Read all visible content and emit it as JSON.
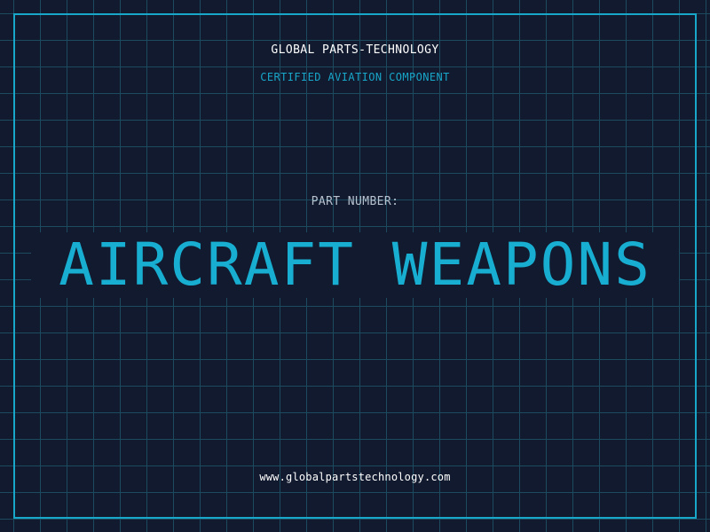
{
  "header": {
    "company": "GLOBAL PARTS-TECHNOLOGY",
    "subtitle": "CERTIFIED AVIATION COMPONENT"
  },
  "part": {
    "label": "PART NUMBER:",
    "name": "AIRCRAFT WEAPONS"
  },
  "footer": {
    "website": "www.globalpartstechnology.com"
  },
  "colors": {
    "background": "#111a2e",
    "grid": "#1c4a5e",
    "accent": "#18a6c9",
    "text": "#ffffff"
  }
}
